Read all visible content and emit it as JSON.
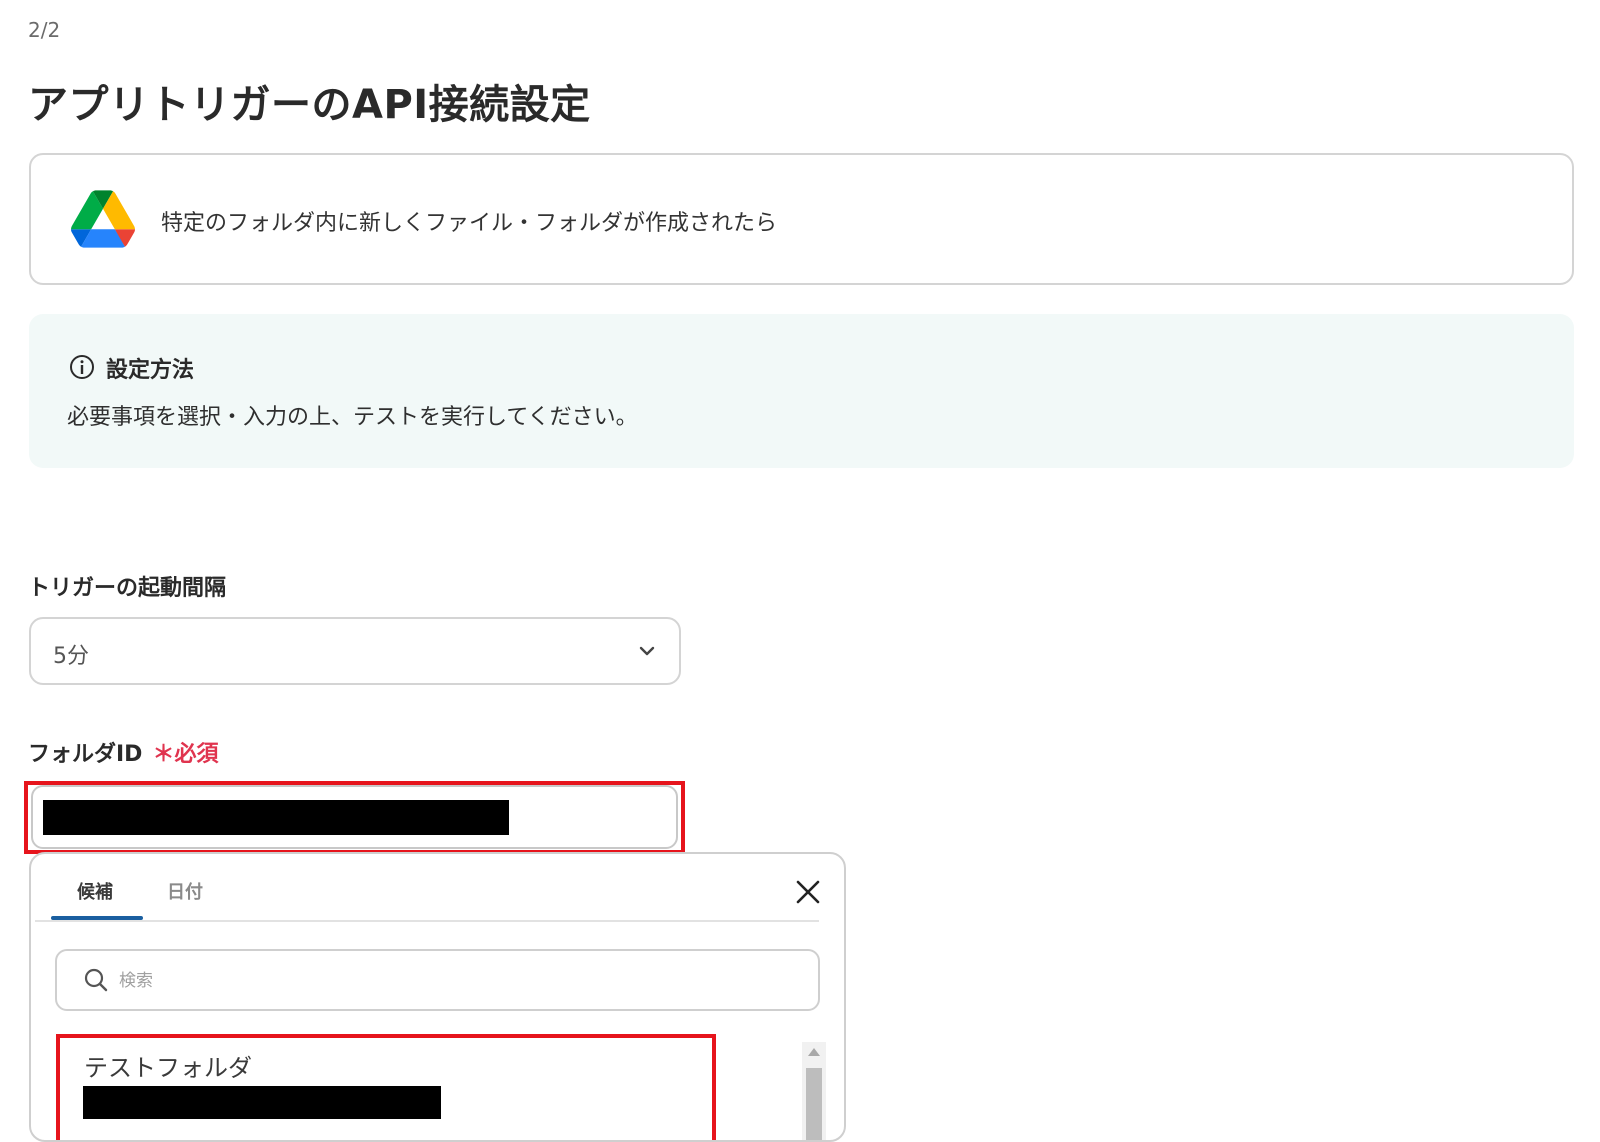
{
  "header": {
    "step": "2/2",
    "title": "アプリトリガーのAPI接続設定"
  },
  "trigger": {
    "icon": "google-drive-icon",
    "label": "特定のフォルダ内に新しくファイル・フォルダが作成されたら"
  },
  "info": {
    "icon": "info-icon",
    "title": "設定方法",
    "description": "必要事項を選択・入力の上、テストを実行してください。"
  },
  "interval_field": {
    "label": "トリガーの起動間隔",
    "value": "5分",
    "icon": "chevron-down-icon"
  },
  "folder_field": {
    "label": "フォルダID",
    "required_label": "＊必須"
  },
  "popover": {
    "tabs": [
      {
        "label": "候補",
        "active": true
      },
      {
        "label": "日付",
        "active": false
      }
    ],
    "close_icon": "close-icon",
    "search": {
      "icon": "search-icon",
      "placeholder": "検索"
    },
    "items": [
      {
        "title": "テストフォルダ"
      }
    ]
  },
  "colors": {
    "highlight": "#e6141c",
    "required": "#e0344f",
    "tab_accent": "#1a5fa0",
    "info_background": "#f2f9f8"
  }
}
